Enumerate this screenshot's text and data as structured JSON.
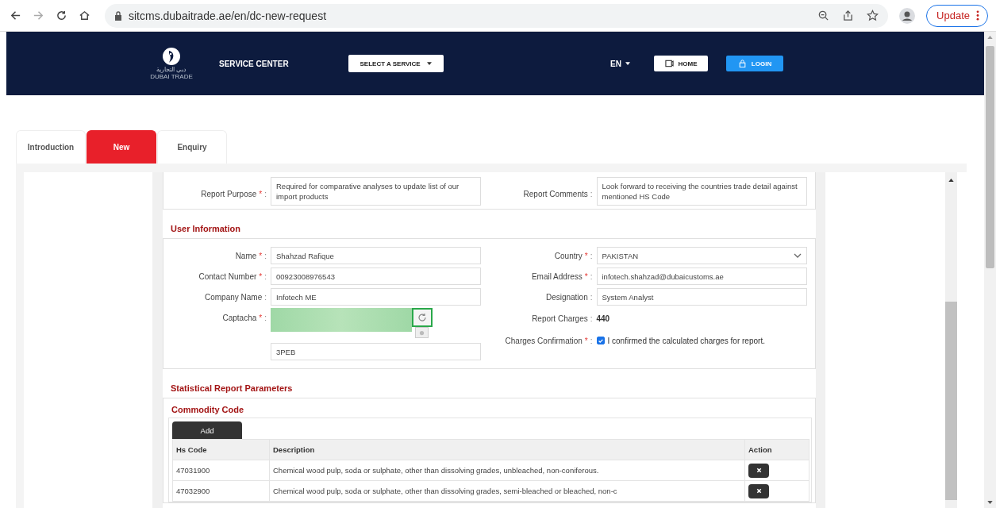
{
  "browser": {
    "url": "sitcms.dubaitrade.ae/en/dc-new-request",
    "update_button": "Update"
  },
  "header": {
    "logo_caption_ar": "دبي التجارية",
    "logo_caption": "DUBAI TRADE",
    "title": "SERVICE CENTER",
    "service_select": "SELECT A SERVICE",
    "language": "EN",
    "home_button": "HOME",
    "login_button": "LOGIN"
  },
  "tabs": [
    {
      "label": "Introduction",
      "selected": false
    },
    {
      "label": "New",
      "selected": true
    },
    {
      "label": "Enquiry",
      "selected": false
    }
  ],
  "report": {
    "fields": [
      {
        "label": "Report Purpose",
        "required_mark": "*",
        "separator": ":",
        "value": "Required for comparative analyses to update list of our import products"
      },
      {
        "label": "Report Comments",
        "separator": ":",
        "value": "Look forward to receiving the countries trade detail against mentioned HS Code"
      }
    ]
  },
  "user_information": {
    "heading": "User Information",
    "left_fields": [
      {
        "kind": "input",
        "label": "Name",
        "required_mark": "*",
        "separator": ":",
        "value": "Shahzad Rafique"
      },
      {
        "kind": "input",
        "label": "Contact Number",
        "required_mark": "*",
        "separator": ":",
        "value": "00923008976543"
      },
      {
        "kind": "input",
        "label": "Company Name",
        "separator": ":",
        "value": "Infotech ME"
      },
      {
        "kind": "captcha",
        "label": "Captacha",
        "required_mark": "*",
        "separator": ":",
        "value": "3PEB"
      }
    ],
    "right_fields": [
      {
        "kind": "select",
        "label": "Country",
        "required_mark": "*",
        "separator": ":",
        "value": "PAKISTAN"
      },
      {
        "kind": "input",
        "label": "Email Address",
        "required_mark": "*",
        "separator": ":",
        "value": "infotech.shahzad@dubaicustoms.ae"
      },
      {
        "kind": "input",
        "label": "Designation",
        "separator": ":",
        "value": "System Analyst"
      },
      {
        "kind": "text",
        "label": "Report Charges",
        "separator": ":",
        "value": "440"
      },
      {
        "kind": "checkbox",
        "label": "Charges Confirmation",
        "required_mark": "*",
        "separator": ":",
        "checked": true,
        "text": "I confirmed the calculated charges for report."
      }
    ]
  },
  "statistical": {
    "heading": "Statistical Report Parameters",
    "commodity": {
      "heading": "Commodity Code",
      "add_button": "Add",
      "columns": [
        "Hs Code",
        "Description",
        "Action"
      ],
      "rows": [
        {
          "hs_code": "47031900",
          "description": "Chemical wood pulp, soda or sulphate, other than dissolving grades, unbleached, non-coniferous."
        },
        {
          "hs_code": "47032900",
          "description": "Chemical wood pulp, soda or sulphate, other than dissolving grades, semi-bleached or bleached, non-c"
        }
      ]
    }
  }
}
